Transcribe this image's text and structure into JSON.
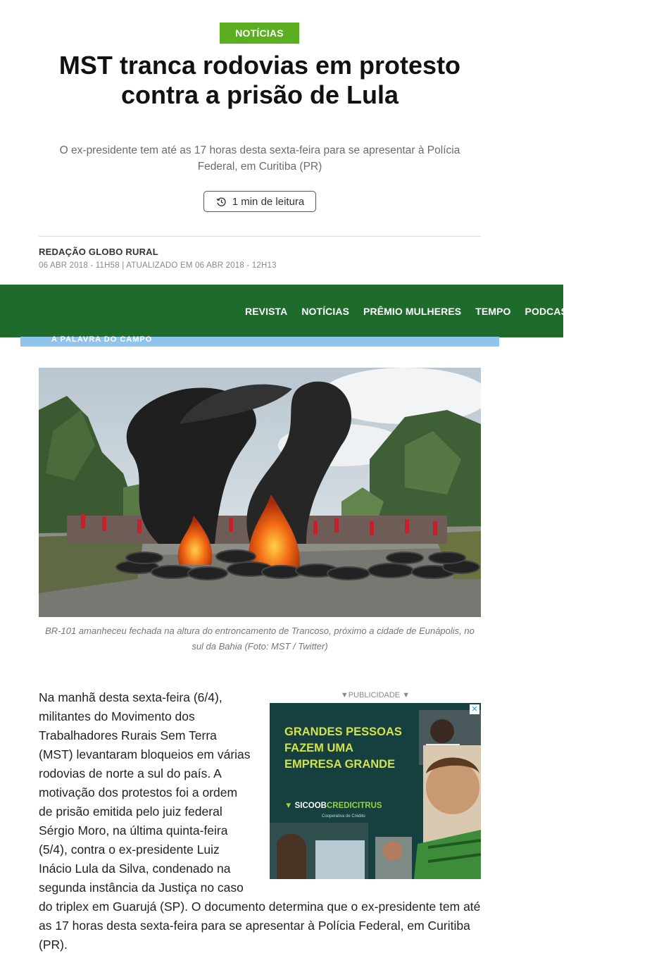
{
  "article": {
    "category": "NOTÍCIAS",
    "title": "MST tranca rodovias em protesto contra a prisão de Lula",
    "subtitle": "O ex-presidente tem até as 17 horas desta sexta-feira para se apresentar à Polícia Federal, em Curitiba (PR)",
    "read_time": "1 min de leitura",
    "author": "REDAÇÃO GLOBO RURAL",
    "published": "06 ABR 2018 - 11H58",
    "separator": "|",
    "updated": "ATUALIZADO EM 06 ABR 2018 - 12H13",
    "image_caption": "BR-101 amanheceu fechada na altura do entroncamento de Trancoso, próximo a cidade de Eunápolis, no sul da Bahia (Foto: MST / Twitter)",
    "body": "Na manhã desta sexta-feira (6/4), militantes do Movimento dos Trabalhadores Rurais Sem Terra (MST) levantaram bloqueios em várias rodovias de norte a sul do país. A motivação dos protestos foi a ordem de prisão emitida pelo juiz federal Sérgio Moro, na última quinta-feira (5/4), contra o ex-presidente Luiz Inácio Lula da Silva, condenado na segunda instância da Justiça no caso do triplex em Guarujá (SP). O documento determina que o ex-presidente tem até as 17 horas desta sexta-feira para se apresentar à Polícia Federal, em Curitiba (PR)."
  },
  "nav": {
    "items": [
      "REVISTA",
      "NOTÍCIAS",
      "PRÊMIO MULHERES",
      "TEMPO",
      "PODCASTS"
    ],
    "tagline": "A PALAVRA DO CAMPO"
  },
  "ad": {
    "label": "▼PUBLICIDADE ▼",
    "headline": "GRANDES PESSOAS FAZEM UMA EMPRESA GRANDE",
    "brand_a": "SICOOB",
    "brand_b": "CREDICITRUS",
    "brand_sub": "Cooperativa de Crédito",
    "close": "✕"
  },
  "colors": {
    "category_badge": "#5aae20",
    "navbar": "#1e6b2c",
    "tagline_bar": "#8fc4ef",
    "ad_background": "#15403f",
    "ad_headline": "#d4e24a"
  }
}
